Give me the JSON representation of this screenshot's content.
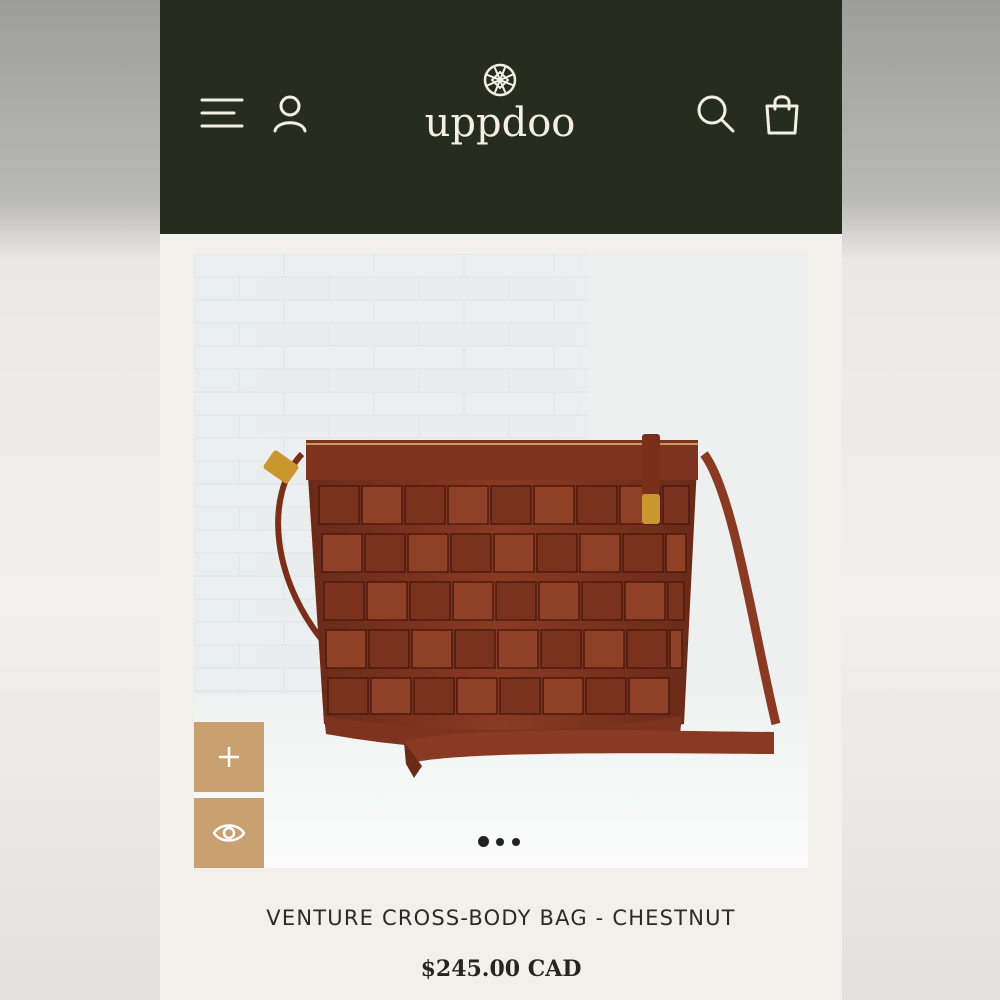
{
  "header": {
    "brand": "uppdoo",
    "icons": [
      "menu-icon",
      "account-icon",
      "search-icon",
      "cart-icon"
    ]
  },
  "product": {
    "image_dots": {
      "count": 3,
      "active": 1
    },
    "actions": [
      "plus-icon",
      "eye-icon"
    ],
    "title": "VENTURE CROSS-BODY BAG - CHESTNUT",
    "price": "$245.00 CAD"
  },
  "colors": {
    "header_bg": "#262d1c",
    "action_bg": "#c9a06f",
    "page_bg": "#f1f0eb"
  }
}
